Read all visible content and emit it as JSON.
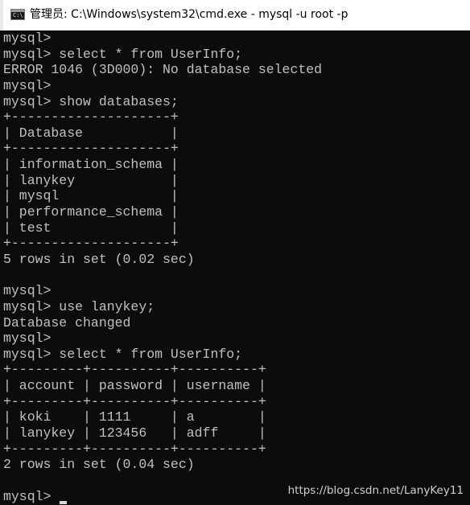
{
  "window": {
    "title": "管理员: C:\\Windows\\system32\\cmd.exe - mysql  -u root -p",
    "icon": "cmd-icon",
    "icon_glyph": "C:\\"
  },
  "console": {
    "lines": [
      "mysql>",
      "mysql> select * from UserInfo;",
      "ERROR 1046 (3D000): No database selected",
      "mysql>",
      "mysql> show databases;",
      "+--------------------+",
      "| Database           |",
      "+--------------------+",
      "| information_schema |",
      "| lanykey            |",
      "| mysql              |",
      "| performance_schema |",
      "| test               |",
      "+--------------------+",
      "5 rows in set (0.02 sec)",
      "",
      "mysql>",
      "mysql> use lanykey;",
      "Database changed",
      "mysql>",
      "mysql> select * from UserInfo;",
      "+---------+----------+----------+",
      "| account | password | username |",
      "+---------+----------+----------+",
      "| koki    | 1111     | a        |",
      "| lanykey | 123456   | adff     |",
      "+---------+----------+----------+",
      "2 rows in set (0.04 sec)",
      "",
      "mysql> "
    ]
  },
  "watermark": "https://blog.csdn.net/LanyKey11",
  "colors": {
    "console_background": "#0c0c0c",
    "console_text": "#c0c0c0",
    "titlebar_background": "#ffffff"
  }
}
